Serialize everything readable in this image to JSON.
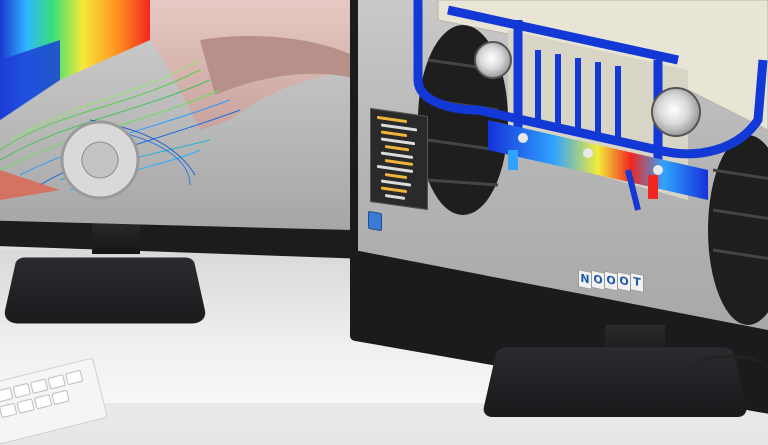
{
  "scene": {
    "left_monitor": {
      "content": "cfd-simulation-race-car",
      "accent": "#2f7bd6"
    },
    "right_monitor": {
      "content": "fea-stress-vehicle-front",
      "accent": "#1238d6"
    },
    "cad_tree": {
      "line_count": 12
    },
    "icon_strip": {
      "letters": [
        "N",
        "O",
        "O",
        "O",
        "T"
      ]
    }
  }
}
